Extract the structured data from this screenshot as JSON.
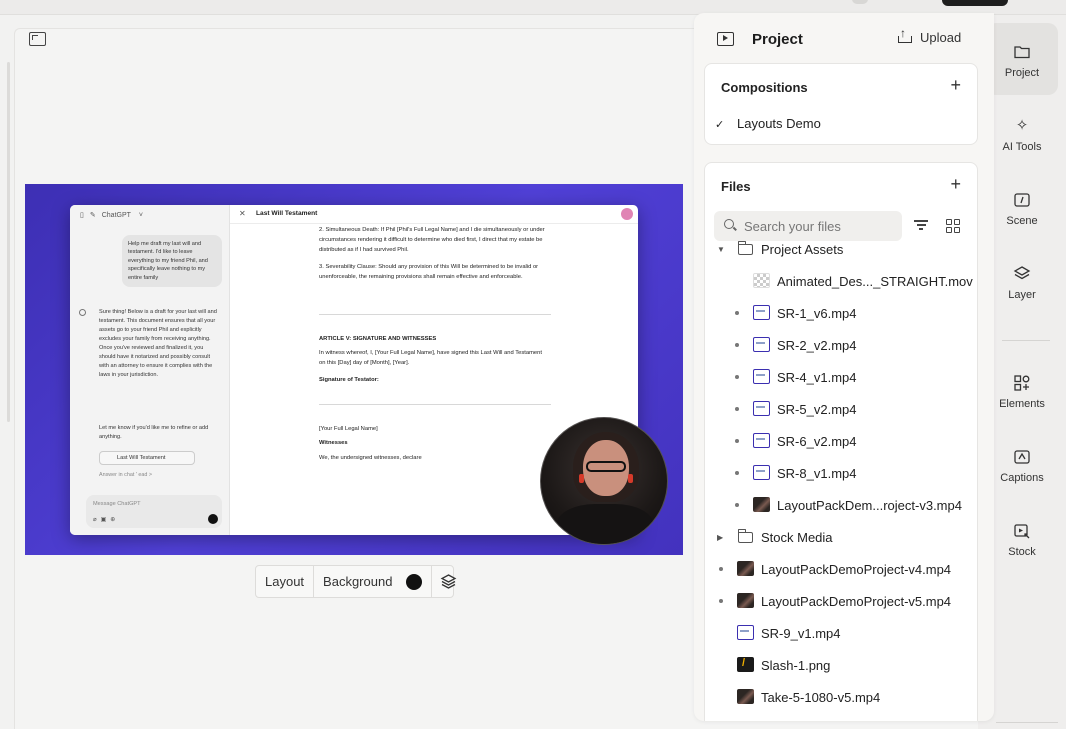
{
  "panel": {
    "title": "Project",
    "upload_label": "Upload"
  },
  "compositions": {
    "title": "Compositions",
    "items": [
      {
        "label": "Layouts Demo",
        "selected": true
      }
    ]
  },
  "files": {
    "title": "Files",
    "search_placeholder": "Search your files",
    "tree": [
      {
        "name": "Project Assets",
        "kind": "folder",
        "expanded": true
      },
      {
        "name": "Animated_Des..._STRAIGHT.mov",
        "kind": "transparent"
      },
      {
        "name": "SR-1_v6.mp4",
        "kind": "screen"
      },
      {
        "name": "SR-2_v2.mp4",
        "kind": "screen"
      },
      {
        "name": "SR-4_v1.mp4",
        "kind": "screen"
      },
      {
        "name": "SR-5_v2.mp4",
        "kind": "screen"
      },
      {
        "name": "SR-6_v2.mp4",
        "kind": "screen"
      },
      {
        "name": "SR-8_v1.mp4",
        "kind": "screen"
      },
      {
        "name": "LayoutPackDem...roject-v3.mp4",
        "kind": "person"
      },
      {
        "name": "Stock Media",
        "kind": "folder",
        "expanded": false
      },
      {
        "name": "LayoutPackDemoProject-v4.mp4",
        "kind": "person"
      },
      {
        "name": "LayoutPackDemoProject-v5.mp4",
        "kind": "person"
      },
      {
        "name": "SR-9_v1.mp4",
        "kind": "screen"
      },
      {
        "name": "Slash-1.png",
        "kind": "png"
      },
      {
        "name": "Take-5-1080-v5.mp4",
        "kind": "person"
      }
    ]
  },
  "rail": [
    {
      "label": "Project",
      "icon": "folder-icon",
      "active": true
    },
    {
      "label": "AI Tools",
      "icon": "sparkle-icon"
    },
    {
      "label": "Scene",
      "icon": "scene-icon"
    },
    {
      "label": "Layer",
      "icon": "layers-icon"
    },
    {
      "label": "Elements",
      "icon": "elements-icon"
    },
    {
      "label": "Captions",
      "icon": "captions-icon"
    },
    {
      "label": "Stock",
      "icon": "stock-icon"
    }
  ],
  "layout_bar": {
    "layout_label": "Layout",
    "background_label": "Background",
    "background_color": "#111111"
  },
  "preview": {
    "chat_app": "ChatGPT",
    "doc_title": "Last Will Testament",
    "user_prompt": "Help me draft my last will and testament. I'd like to leave everything to my friend Phil, and specifically leave nothing to my entire family",
    "bot_reply": "Sure thing! Below is a draft for your last will and testament. This document ensures that all your assets go to your friend Phil and explicitly excludes your family from receiving anything. Once you've reviewed and finalized it, you should have it notarized and possibly consult with an attorney to ensure it complies with the laws in your jurisdiction.",
    "bot_reply_2": "Let me know if you'd like me to refine or add anything.",
    "chip_label": "Last Will Testament",
    "answer_chat": "Answer in chat ' ead >",
    "message_placeholder": "Message ChatGPT",
    "clause_2": "Simultaneous Death: If Phil [Phil's Full Legal Name] and I die simultaneously or under circumstances rendering it difficult to determine who died first, I direct that my estate be distributed as if I had survived Phil.",
    "clause_3": "Severability Clause: Should any provision of this Will be determined to be invalid or unenforceable, the remaining provisions shall remain effective and enforceable.",
    "article_title": "ARTICLE V: SIGNATURE AND WITNESSES",
    "article_text": "In witness whereof, I, [Your Full Legal Name], have signed this Last Will and Testament on this [Day] day of [Month], [Year].",
    "sig_label": "Signature of Testator:",
    "full_name": "[Your Full Legal Name]",
    "witnesses": "Witnesses",
    "witness_text": "We, the undersigned witnesses, declare"
  }
}
